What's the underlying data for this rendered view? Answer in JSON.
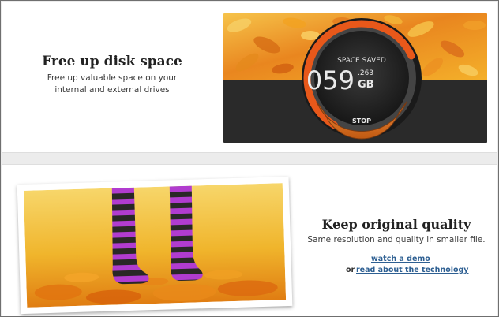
{
  "feature_disk_space": {
    "title": "Free up disk space",
    "description": "Free up valuable space on your internal and external drives",
    "widget": {
      "label": "SPACE SAVED",
      "main_number": "059",
      "decimal": ".263",
      "unit": "GB",
      "button_label": "STOP",
      "progress_fraction": 0.72
    }
  },
  "feature_quality": {
    "title": "Keep original quality",
    "description": "Same resolution and quality in smaller file.",
    "demo_link": "watch a demo",
    "or_text": "or",
    "tech_link": "read about the technology"
  },
  "colors": {
    "accent_orange": "#e8581a",
    "leaves_gold": "#f4b02a",
    "dark_band": "#2a2a2a",
    "link_blue": "#2d5f92"
  }
}
